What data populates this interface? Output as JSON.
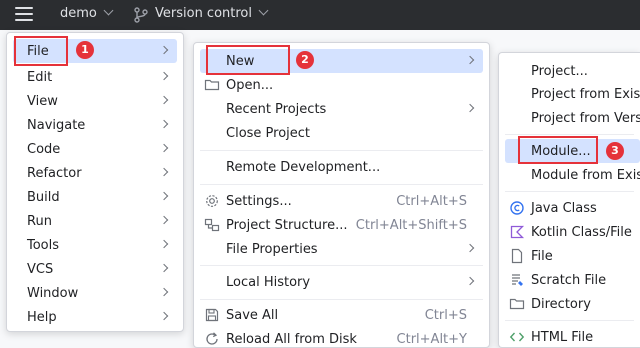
{
  "topbar": {
    "project": "demo",
    "vcs": "Version control"
  },
  "menu_main": {
    "items": [
      {
        "label": "File"
      },
      {
        "label": "Edit"
      },
      {
        "label": "View"
      },
      {
        "label": "Navigate"
      },
      {
        "label": "Code"
      },
      {
        "label": "Refactor"
      },
      {
        "label": "Build"
      },
      {
        "label": "Run"
      },
      {
        "label": "Tools"
      },
      {
        "label": "VCS"
      },
      {
        "label": "Window"
      },
      {
        "label": "Help"
      }
    ]
  },
  "menu_file": {
    "items": [
      {
        "label": "New"
      },
      {
        "label": "Open..."
      },
      {
        "label": "Recent Projects"
      },
      {
        "label": "Close Project"
      },
      {
        "label": "Remote Development..."
      },
      {
        "label": "Settings...",
        "shortcut": "Ctrl+Alt+S"
      },
      {
        "label": "Project Structure...",
        "shortcut": "Ctrl+Alt+Shift+S"
      },
      {
        "label": "File Properties"
      },
      {
        "label": "Local History"
      },
      {
        "label": "Save All",
        "shortcut": "Ctrl+S"
      },
      {
        "label": "Reload All from Disk",
        "shortcut": "Ctrl+Alt+Y"
      }
    ]
  },
  "menu_new": {
    "items": [
      {
        "label": "Project..."
      },
      {
        "label": "Project from Exist"
      },
      {
        "label": "Project from Vers"
      },
      {
        "label": "Module..."
      },
      {
        "label": "Module from Exist"
      },
      {
        "label": "Java Class"
      },
      {
        "label": "Kotlin Class/File"
      },
      {
        "label": "File"
      },
      {
        "label": "Scratch File"
      },
      {
        "label": "Directory"
      },
      {
        "label": "HTML File"
      }
    ]
  },
  "annotations": {
    "badge1": "1",
    "badge2": "2",
    "badge3": "3",
    "color": "#e5323a"
  },
  "colors": {
    "topbar": "#2b2d30",
    "selection": "#d4e2ff"
  }
}
